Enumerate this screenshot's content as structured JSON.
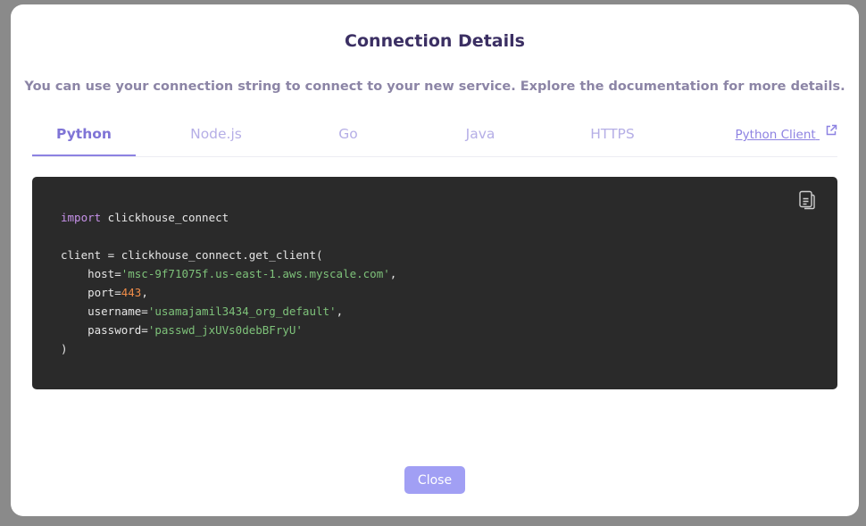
{
  "dialog": {
    "title": "Connection Details",
    "subtitle": "You can use your connection string to connect to your new service. Explore the documentation for more details."
  },
  "tabs": [
    {
      "label": "Python",
      "active": true
    },
    {
      "label": "Node.js",
      "active": false
    },
    {
      "label": "Go",
      "active": false
    },
    {
      "label": "Java",
      "active": false
    },
    {
      "label": "HTTPS",
      "active": false
    }
  ],
  "client_link": {
    "label": "Python Client",
    "icon": "external-link-icon"
  },
  "code": {
    "import_kw": "import",
    "module": " clickhouse_connect",
    "client_line": "client = clickhouse_connect.get_client(",
    "host_key": "    host=",
    "host_val": "'msc-9f71075f.us-east-1.aws.myscale.com'",
    "port_key": "    port=",
    "port_val": "443",
    "username_key": "    username=",
    "username_val": "'usamajamil3434_org_default'",
    "password_key": "    password=",
    "password_val": "'passwd_jxUVs0debBFryU'",
    "closing": ")",
    "comma": ",",
    "copy_icon": "copy-icon"
  },
  "footer": {
    "close_label": "Close"
  },
  "colors": {
    "accent": "#8d82e2",
    "code_bg": "#2a2a2a",
    "string": "#7ec27a",
    "number": "#f08d49",
    "keyword": "#c792ea",
    "close_button": "#a19ff4"
  }
}
